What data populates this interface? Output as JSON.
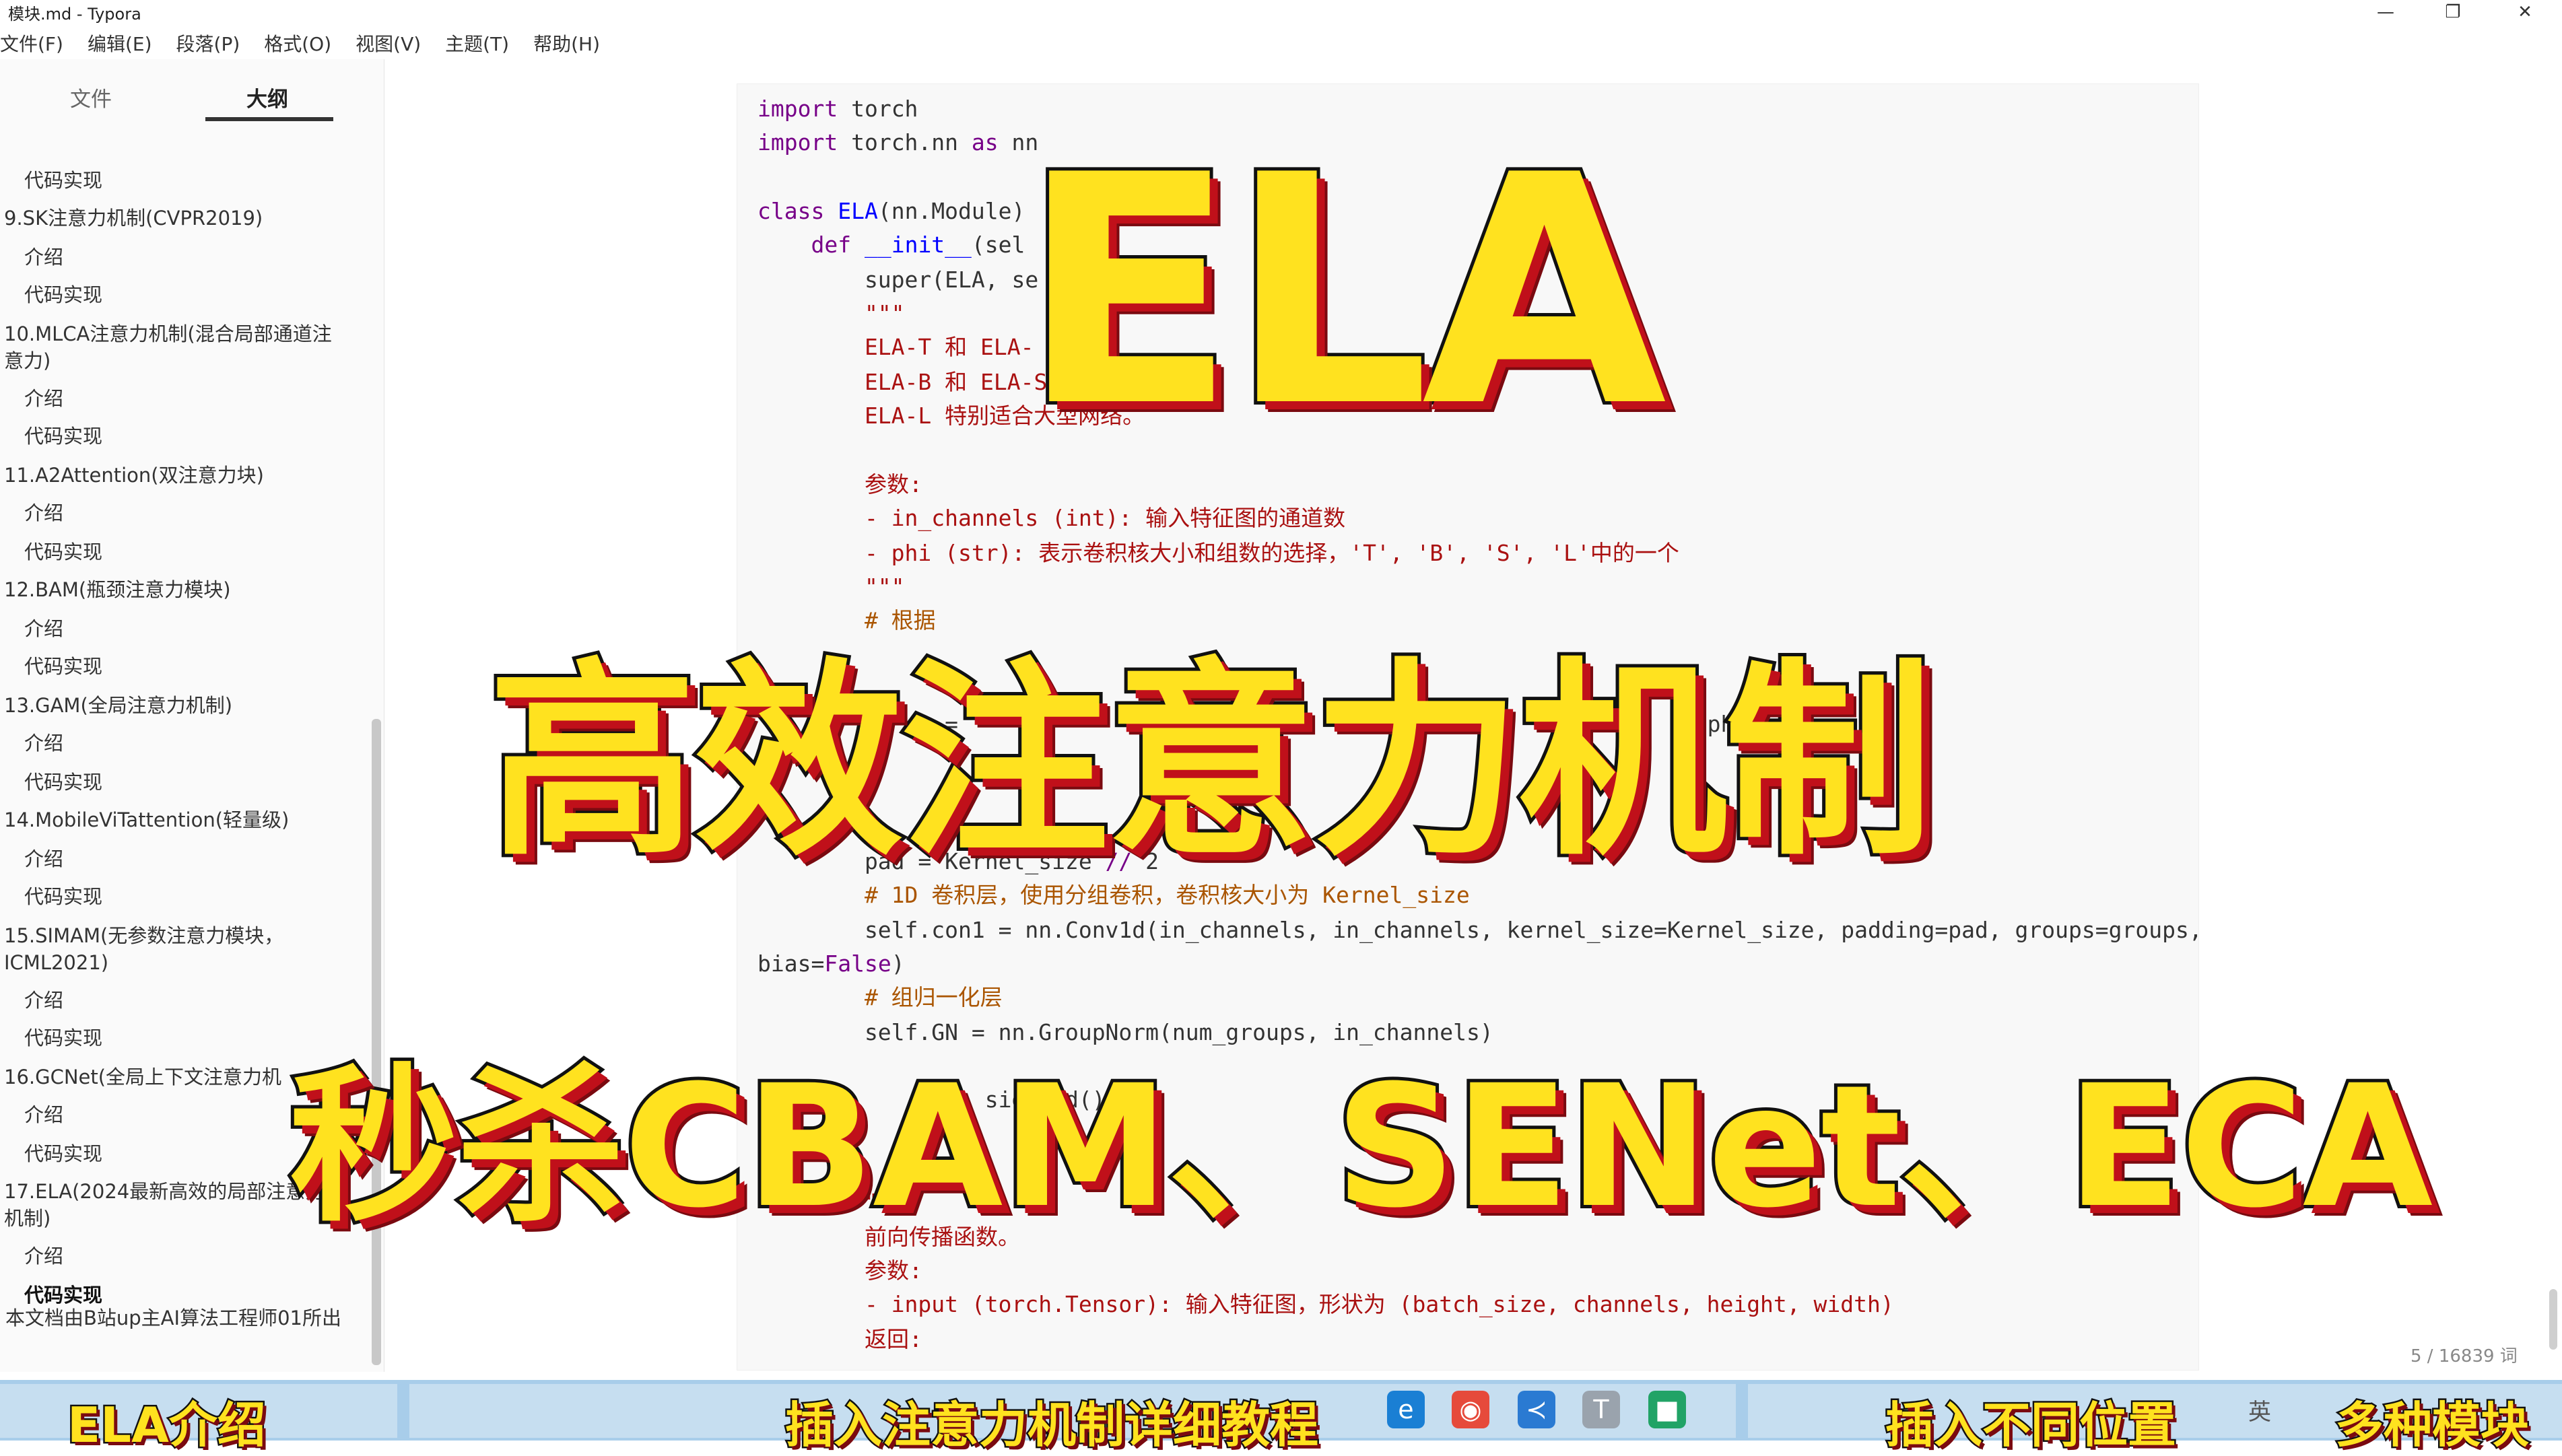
{
  "window": {
    "title": "模块.md - Typora",
    "minimize": "—",
    "maximize": "❐",
    "close": "✕"
  },
  "menu": [
    "文件(F)",
    "编辑(E)",
    "段落(P)",
    "格式(O)",
    "视图(V)",
    "主题(T)",
    "帮助(H)"
  ],
  "sidebar": {
    "tabs": [
      "文件",
      "大纲"
    ],
    "outline": [
      "代码实现",
      "9.SK注意力机制(CVPR2019)",
      "介绍",
      "代码实现",
      "10.MLCA注意力机制(混合局部通道注意力)",
      "介绍",
      "代码实现",
      "11.A2Attention(双注意力块)",
      "介绍",
      "代码实现",
      "12.BAM(瓶颈注意力模块)",
      "介绍",
      "代码实现",
      "13.GAM(全局注意力机制)",
      "介绍",
      "代码实现",
      "14.MobileViTattention(轻量级)",
      "介绍",
      "代码实现",
      "15.SIMAM(无参数注意力模块，ICML2021)",
      "介绍",
      "代码实现",
      "16.GCNet(全局上下文注意力机",
      "介绍",
      "代码实现",
      "17.ELA(2024最新高效的局部注意力机制)",
      "介绍",
      "代码实现"
    ],
    "footer": "本文档由B站up主AI算法工程师01所出",
    "bottom_left": "‹",
    "bottom_code": "</>"
  },
  "code": [
    "import torch",
    "import torch.nn as nn",
    "",
    "class ELA(nn.Module)",
    "    def __init__(sel",
    "        super(ELA, se",
    "        \"\"\"",
    "        ELA-T 和 ELA-                               的 CNN 架构",
    "        ELA-B 和 ELA-S",
    "        ELA-L 特别适合大型网络。",
    "",
    "        参数:",
    "        - in_channels (int): 输入特征图的通道数",
    "        - phi (str): 表示卷积核大小和组数的选择，'T', 'B', 'S', 'L'中的一个",
    "        \"\"\"",
    "        # 根据",
    "",
    "",
    "            s =                  nnels      i                          phi]",
    "",
    "",
    "",
    "        pad = Kernel_size // 2",
    "        # 1D 卷积层，使用分组卷积，卷积核大小为 Kernel_size",
    "        self.con1 = nn.Conv1d(in_channels, in_channels, kernel_size=Kernel_size, padding=pad, groups=groups,",
    "bias=False)",
    "        # 组归一化层",
    "        self.GN = nn.GroupNorm(num_groups, in_channels)",
    "",
    "                 sigmoid()",
    "",
    "",
    "        \"\"\"",
    "        前向传播函数。",
    "        参数:",
    "        - input (torch.Tensor): 输入特征图，形状为 (batch_size, channels, height, width)",
    "        返回:"
  ],
  "status": {
    "wordcount": "5 / 16839 词"
  },
  "overlay": {
    "line1": "ELA",
    "line2": "高效注意力机制",
    "line3": "秒杀CBAM、SENet、ECA"
  },
  "taskbar": {
    "label_left": "ELA介绍",
    "label_mid": "插入注意力机制详细教程",
    "label_right1": "插入不同位置",
    "label_right2": "多种模块",
    "ime": "英"
  },
  "colors": {
    "overlay_fill": "#ffe21f",
    "overlay_shadow": "#c0101a",
    "taskbar": "#a8cdea"
  }
}
